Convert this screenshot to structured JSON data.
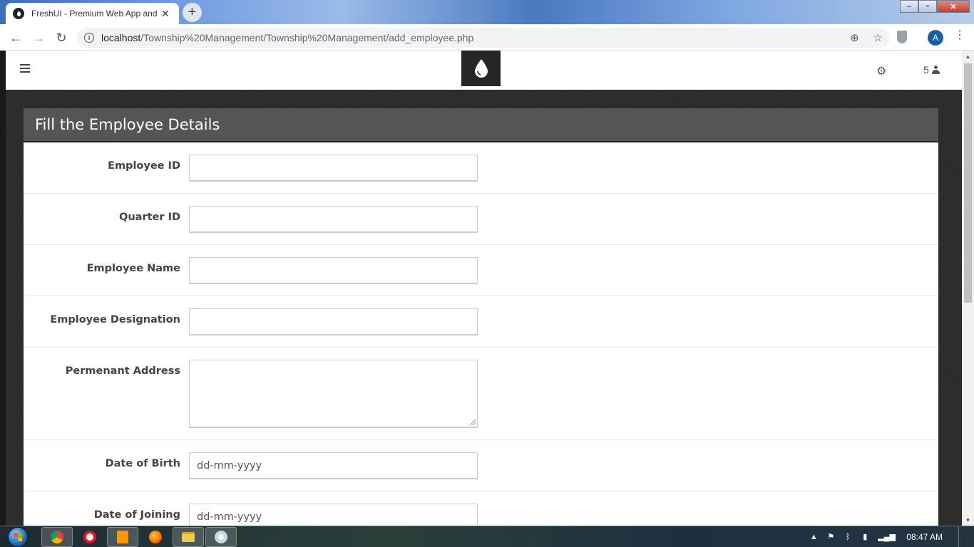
{
  "browser": {
    "tab_title": "FreshUI - Premium Web App and",
    "url_host": "localhost",
    "url_path": "/Township%20Management/Township%20Management/add_employee.php",
    "profile_initial": "A"
  },
  "header": {
    "user_count": "5"
  },
  "form": {
    "title": "Fill the Employee Details",
    "fields": [
      {
        "label": "Employee ID",
        "value": ""
      },
      {
        "label": "Quarter ID",
        "value": ""
      },
      {
        "label": "Employee Name",
        "value": ""
      },
      {
        "label": "Employee Designation",
        "value": ""
      },
      {
        "label": "Permenant Address",
        "value": ""
      },
      {
        "label": "Date of Birth",
        "value": "dd-mm-yyyy"
      },
      {
        "label": "Date of Joining",
        "value": "dd-mm-yyyy"
      }
    ]
  },
  "taskbar": {
    "clock": "08:47 AM"
  },
  "colors": {
    "panel_header": "#555555",
    "page_background": "#2b2b2b",
    "logo_background": "#262626",
    "profile_chip": "#1a5ea8"
  }
}
